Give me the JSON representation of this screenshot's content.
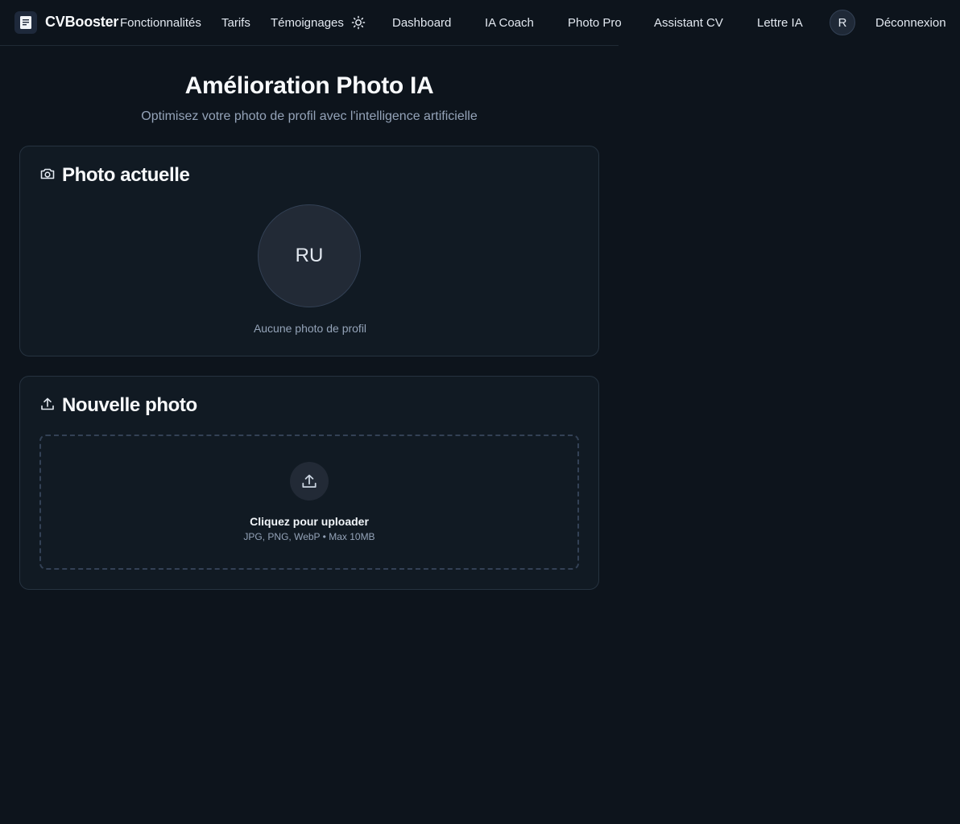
{
  "header": {
    "brand": "CVBooster",
    "nav": [
      "Fonctionnalités",
      "Tarifs",
      "Témoignages"
    ],
    "app_nav": [
      "Dashboard",
      "IA Coach",
      "Photo Pro",
      "Assistant CV",
      "Lettre IA"
    ],
    "user_initial": "R",
    "logout": "Déconnexion"
  },
  "page": {
    "title": "Amélioration Photo IA",
    "subtitle": "Optimisez votre photo de profil avec l'intelligence artificielle"
  },
  "current_photo": {
    "title": "Photo actuelle",
    "initials": "RU",
    "empty_text": "Aucune photo de profil"
  },
  "new_photo": {
    "title": "Nouvelle photo",
    "upload_label": "Cliquez pour uploader",
    "upload_hint": "JPG, PNG, WebP • Max 10MB"
  },
  "icons": {
    "logo": "document-icon",
    "theme": "sun-icon",
    "current_photo": "camera-icon",
    "new_photo": "upload-icon"
  },
  "colors": {
    "background": "#0d141c",
    "card": "#111a23",
    "border": "#263340",
    "muted": "#94a3b8"
  }
}
